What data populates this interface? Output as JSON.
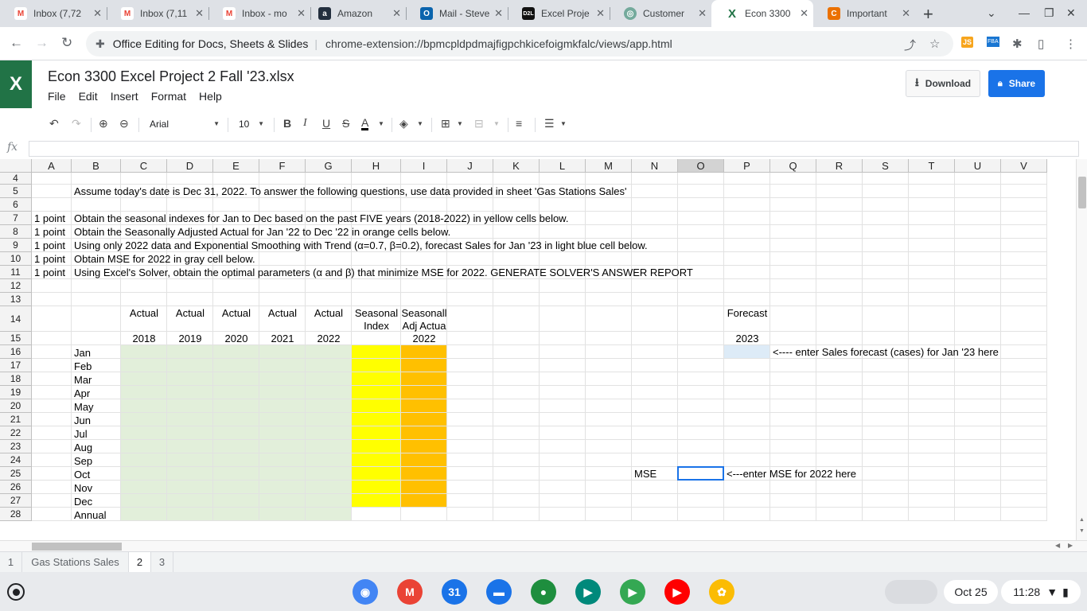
{
  "browser": {
    "tabs": [
      {
        "label": "Inbox (7,72",
        "icon": "gmail-icon",
        "favicon_text": "M",
        "favicon_color": "#ea4335"
      },
      {
        "label": "Inbox (7,11",
        "icon": "gmail-icon",
        "favicon_text": "M",
        "favicon_color": "#ea4335"
      },
      {
        "label": "Inbox - mo",
        "icon": "gmail-icon",
        "favicon_text": "M",
        "favicon_color": "#ea4335"
      },
      {
        "label": "Amazon",
        "icon": "amazon-icon",
        "favicon_text": "a",
        "favicon_color": "#232f3e"
      },
      {
        "label": "Mail - Steve",
        "icon": "outlook-icon",
        "favicon_text": "O",
        "favicon_color": "#0a64ad"
      },
      {
        "label": "Excel Proje",
        "icon": "d2l-icon",
        "favicon_text": "D2L",
        "favicon_color": "#111111"
      },
      {
        "label": "Customer",
        "icon": "chatgpt-icon",
        "favicon_text": "◎",
        "favicon_color": "#74aa9c"
      },
      {
        "label": "Econ 3300",
        "icon": "excel-icon",
        "favicon_text": "X",
        "favicon_color": "#ffffff",
        "active": true
      },
      {
        "label": "Important",
        "icon": "chegg-icon",
        "favicon_text": "C",
        "favicon_color": "#eb7100"
      }
    ],
    "address": {
      "site_label": "Office Editing for Docs, Sheets & Slides",
      "url": "chrome-extension://bpmcpldpdmajfigpchkicefoigmkfalc/views/app.html"
    }
  },
  "app": {
    "doc_title": "Econ 3300 Excel Project 2 Fall '23.xlsx",
    "menu": [
      "File",
      "Edit",
      "Insert",
      "Format",
      "Help"
    ],
    "download_label": "Download",
    "share_label": "Share",
    "font_name": "Arial",
    "font_size": "10",
    "fx_label": "fx"
  },
  "sheet": {
    "columns": [
      "A",
      "B",
      "C",
      "D",
      "E",
      "F",
      "G",
      "H",
      "I",
      "J",
      "K",
      "L",
      "M",
      "N",
      "O",
      "P",
      "Q",
      "R",
      "S",
      "T",
      "U",
      "V"
    ],
    "selected_column": "O",
    "rows": [
      "4",
      "5",
      "6",
      "7",
      "8",
      "9",
      "10",
      "11",
      "12",
      "13",
      "14",
      "15",
      "16",
      "17",
      "18",
      "19",
      "20",
      "21",
      "22",
      "23",
      "24",
      "25",
      "26",
      "27",
      "28"
    ],
    "cells": {
      "B5": "Assume today's date is Dec 31, 2022. To answer the following questions, use data provided in sheet 'Gas Stations Sales'",
      "A7": "1 point",
      "B7": "Obtain the seasonal indexes for Jan to Dec based on the past FIVE years (2018-2022) in yellow cells below.",
      "A8": "1 point",
      "B8": "Obtain the Seasonally Adjusted Actual for Jan '22 to Dec '22 in orange cells below.",
      "A9": "1 point",
      "B9": "Using only 2022 data and Exponential Smoothing with Trend (α=0.7, β=0.2), forecast Sales for Jan '23 in light blue cell below.",
      "A10": "1 point",
      "B10": "Obtain MSE for 2022 in gray cell below.",
      "A11": "1 point",
      "B11": "Using Excel's Solver, obtain the optimal parameters (α and β) that minimize MSE for 2022. GENERATE SOLVER'S ANSWER REPORT",
      "C14": "Actual",
      "D14": "Actual",
      "E14": "Actual",
      "F14": "Actual",
      "G14": "Actual",
      "H14a": "Seasonal",
      "H14b": "Index",
      "I14a": "Seasonall",
      "I14b": "Adj Actua",
      "P14": "Forecast",
      "C15": "2018",
      "D15": "2019",
      "E15": "2020",
      "F15": "2021",
      "G15": "2022",
      "I15": "2022",
      "P15": "2023",
      "Q16": "<---- enter Sales forecast (cases) for Jan '23 here",
      "N25": "MSE",
      "P25": "<---enter MSE for 2022 here"
    },
    "months": [
      "Jan",
      "Feb",
      "Mar",
      "Apr",
      "May",
      "Jun",
      "Jul",
      "Aug",
      "Sep",
      "Oct",
      "Nov",
      "Dec",
      "Annual"
    ],
    "fill_colors": {
      "actual_green": "#e2efda",
      "seasonal_yellow": "#ffff00",
      "adj_orange": "#ffc000",
      "forecast_blue": "#ddebf7",
      "selection_border": "#1a73e8"
    },
    "sheet_tabs": [
      {
        "label": "1",
        "active": false
      },
      {
        "label": "Gas Stations Sales",
        "active": false
      },
      {
        "label": "2",
        "active": true
      },
      {
        "label": "3",
        "active": false
      }
    ]
  },
  "shelf": {
    "apps": [
      {
        "name": "chrome-icon",
        "color": "#4285f4"
      },
      {
        "name": "gmail-icon",
        "color": "#ea4335"
      },
      {
        "name": "calendar-icon",
        "color": "#1a73e8"
      },
      {
        "name": "files-icon",
        "color": "#1a73e8"
      },
      {
        "name": "chat-icon",
        "color": "#1e8e3e"
      },
      {
        "name": "meet-icon",
        "color": "#00897b"
      },
      {
        "name": "play-store-icon",
        "color": "#34a853"
      },
      {
        "name": "youtube-icon",
        "color": "#ff0000"
      },
      {
        "name": "photos-icon",
        "color": "#fbbc04"
      }
    ],
    "date": "Oct 25",
    "time": "11:28"
  }
}
